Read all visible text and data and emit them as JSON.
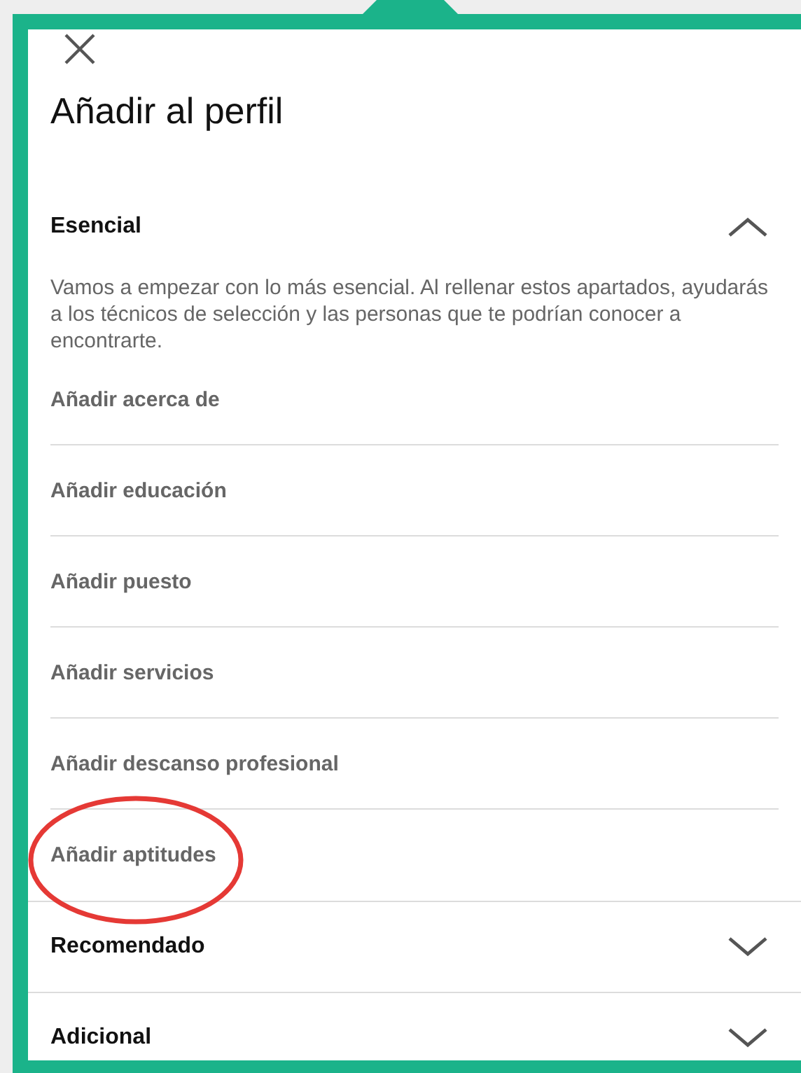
{
  "title": "Añadir al perfil",
  "sections": [
    {
      "title": "Esencial",
      "expanded": true,
      "description": "Vamos a empezar con lo más esencial. Al rellenar estos apartados, ayudarás a los técnicos de selección y las personas que te podrían conocer a encontrarte.",
      "items": [
        {
          "label": "Añadir acerca de",
          "highlighted": false
        },
        {
          "label": "Añadir educación",
          "highlighted": false
        },
        {
          "label": "Añadir puesto",
          "highlighted": false
        },
        {
          "label": "Añadir servicios",
          "highlighted": false
        },
        {
          "label": "Añadir descanso profesional",
          "highlighted": false
        },
        {
          "label": "Añadir aptitudes",
          "highlighted": true
        }
      ]
    },
    {
      "title": "Recomendado",
      "expanded": false
    },
    {
      "title": "Adicional",
      "expanded": false
    }
  ]
}
